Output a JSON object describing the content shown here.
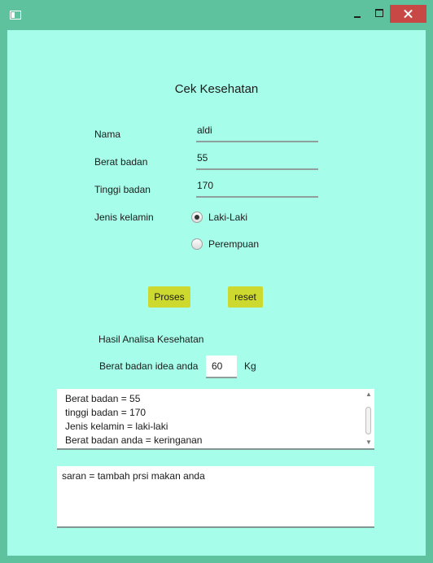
{
  "window": {
    "title": ""
  },
  "form": {
    "title": "Cek Kesehatan",
    "nama_label": "Nama",
    "nama_value": "aldi",
    "berat_label": "Berat badan",
    "berat_value": "55",
    "tinggi_label": "Tinggi badan",
    "tinggi_value": "170",
    "jenis_label": "Jenis kelamin",
    "gender_options": [
      {
        "label": "Laki-Laki",
        "selected": true
      },
      {
        "label": "Perempuan",
        "selected": false
      }
    ]
  },
  "buttons": {
    "proses": "Proses",
    "reset": "reset"
  },
  "hasil": {
    "heading": "Hasil Analisa Kesehatan",
    "ideal_label": "Berat badan idea anda",
    "ideal_value": "60",
    "ideal_unit": "Kg",
    "result_lines": [
      "Berat badan = 55",
      "tinggi badan = 170",
      "Jenis kelamin = laki-laki",
      "Berat badan anda = keringanan"
    ],
    "saran": "saran = tambah prsi makan anda"
  },
  "colors": {
    "window_border": "#5dc29d",
    "content_bg": "#a6feea",
    "button_bg": "#cdd92e",
    "close_button": "#c84845"
  }
}
